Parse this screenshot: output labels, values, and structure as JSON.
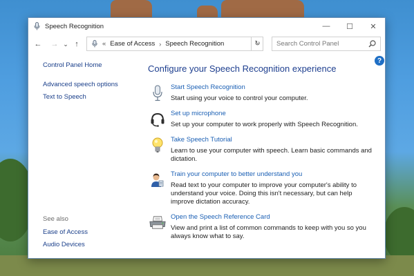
{
  "window": {
    "title": "Speech Recognition",
    "controls": {
      "minimize": "—",
      "maximize": "☐",
      "close": "✕"
    }
  },
  "navigation": {
    "back": "←",
    "forward": "→",
    "recent": "⌄",
    "up": "↑",
    "address_overflow": "«",
    "breadcrumb": [
      "Ease of Access",
      "Speech Recognition"
    ],
    "separator": "›",
    "dropdown": "⌄",
    "refresh": "↻",
    "search_placeholder": "Search Control Panel"
  },
  "help_label": "?",
  "sidebar": {
    "home": "Control Panel Home",
    "links": [
      "Advanced speech options",
      "Text to Speech"
    ],
    "see_also_heading": "See also",
    "see_also_links": [
      "Ease of Access",
      "Audio Devices"
    ]
  },
  "main": {
    "heading": "Configure your Speech Recognition experience",
    "items": [
      {
        "icon": "microphone-icon",
        "link": "Start Speech Recognition",
        "description": "Start using your voice to control your computer."
      },
      {
        "icon": "headset-icon",
        "link": "Set up microphone",
        "description": "Set up your computer to work properly with Speech Recognition."
      },
      {
        "icon": "lightbulb-icon",
        "link": "Take Speech Tutorial",
        "description": "Learn to use your computer with speech.  Learn basic commands and dictation."
      },
      {
        "icon": "user-train-icon",
        "link": "Train your computer to better understand you",
        "description": "Read text to your computer to improve your computer's ability to understand your voice. Doing this isn't necessary, but can help improve dictation accuracy."
      },
      {
        "icon": "printer-icon",
        "link": "Open the Speech Reference Card",
        "description": "View and print a list of common commands to keep with you so you always know what to say."
      }
    ]
  },
  "colors": {
    "link": "#1a5fb4",
    "heading": "#1e3f8f",
    "help_badge": "#1f6fc5"
  }
}
